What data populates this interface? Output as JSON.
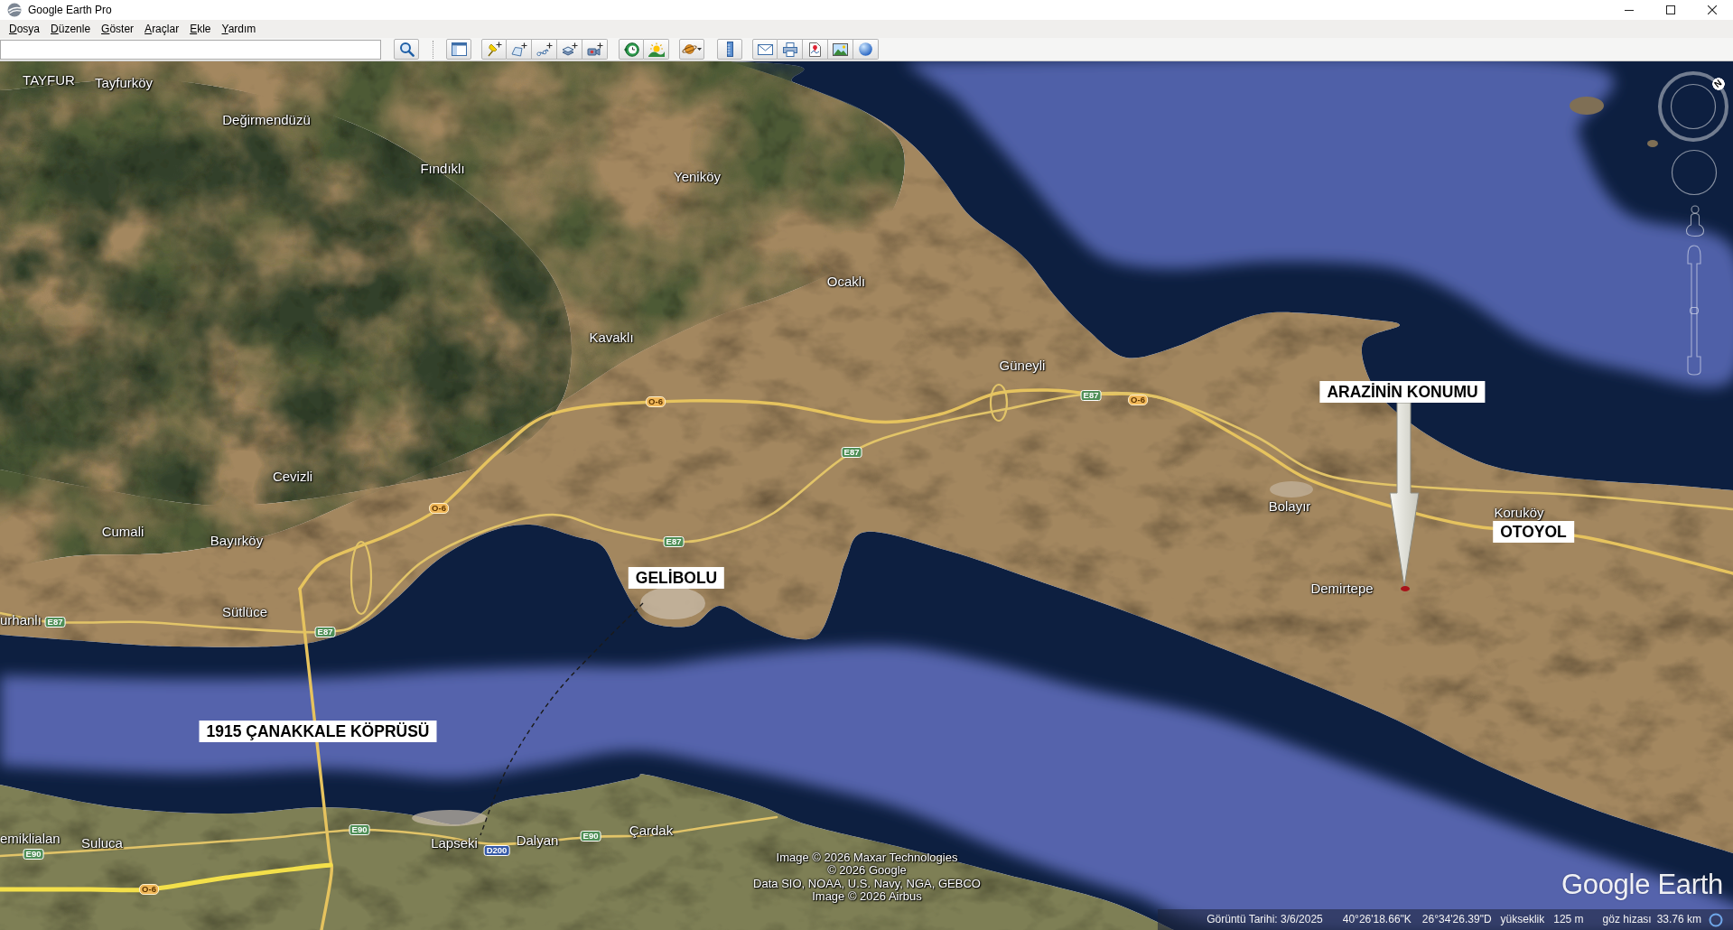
{
  "window": {
    "title": "Google Earth Pro"
  },
  "menu": [
    {
      "label": "Dosya"
    },
    {
      "label": "Düzenle"
    },
    {
      "label": "Göster"
    },
    {
      "label": "Araçlar"
    },
    {
      "label": "Ekle"
    },
    {
      "label": "Yardım"
    }
  ],
  "map": {
    "place_labels": [
      "TAYFUR",
      "Tayfurköy",
      "Değirmendüzü",
      "Fındıklı",
      "Yeniköy",
      "Ocaklı",
      "Kavaklı",
      "Güneyli",
      "Cevizli",
      "Bolayır",
      "Koruköy",
      "Cumali",
      "Bayırköy",
      "Demirtepe",
      "urhanlı",
      "Sütlüce",
      "emiklialan",
      "Suluca",
      "Lapseki",
      "Dalyan",
      "Çardak"
    ],
    "road_shields": [
      {
        "text": "O-6",
        "kind": "motorway"
      },
      {
        "text": "E87",
        "kind": "european"
      },
      {
        "text": "O-6",
        "kind": "motorway"
      },
      {
        "text": "E87",
        "kind": "european"
      },
      {
        "text": "O-6",
        "kind": "motorway"
      },
      {
        "text": "E87",
        "kind": "european"
      },
      {
        "text": "E87",
        "kind": "european"
      },
      {
        "text": "E87",
        "kind": "european"
      },
      {
        "text": "E90",
        "kind": "european"
      },
      {
        "text": "E90",
        "kind": "european"
      },
      {
        "text": "E90",
        "kind": "european"
      },
      {
        "text": "D200",
        "kind": "state"
      },
      {
        "text": "O-6",
        "kind": "motorway"
      }
    ],
    "annotations": [
      {
        "text": "ARAZİNİN KONUMU",
        "arrow": true
      },
      {
        "text": "OTOYOL",
        "arrow": false
      },
      {
        "text": "GELİBOLU",
        "arrow": false
      },
      {
        "text": "1915 ÇANAKKALE KÖPRÜSÜ",
        "arrow": false
      }
    ],
    "attribution": [
      "Image © 2026 Maxar Technologies",
      "© 2026 Google",
      "Data SIO, NOAA, U.S. Navy, NGA, GEBCO",
      "Image © 2026 Airbus"
    ],
    "logo": "Google Earth"
  },
  "navigation": {
    "north_label": "N",
    "zoom_slider": {
      "level": 0.5
    }
  },
  "status_bar": {
    "imagery_date": "Görüntü Tarihi: 3/6/2025",
    "latitude": "40°26'18.66\"K",
    "longitude": "26°34'26.39\"D",
    "elevation_label": "yükseklik",
    "elevation": "125 m",
    "eye_altitude_label": "göz hizası",
    "eye_altitude": "33.76 km"
  }
}
